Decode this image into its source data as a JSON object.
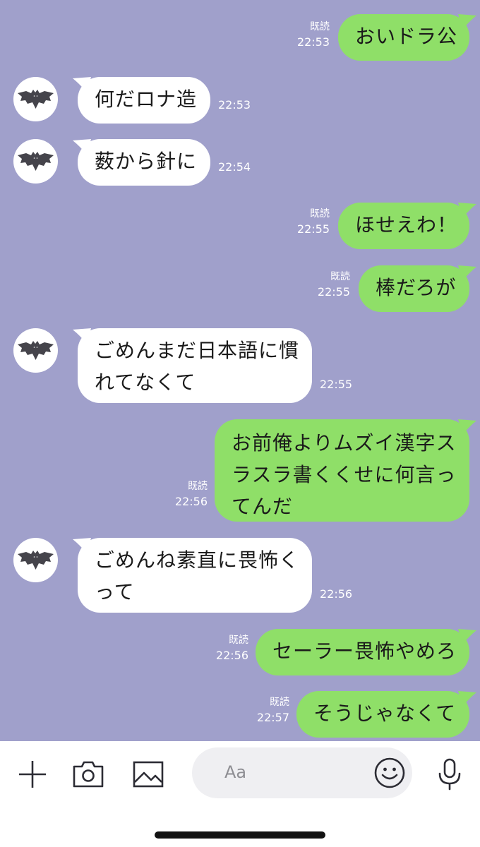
{
  "chat": {
    "read_label": "既読",
    "messages": [
      {
        "side": "out",
        "lines": [
          "おいドラ公"
        ],
        "time": "22:53"
      },
      {
        "side": "in",
        "lines": [
          "何だロナ造"
        ],
        "time": "22:53"
      },
      {
        "side": "in",
        "lines": [
          "薮から針に"
        ],
        "time": "22:54"
      },
      {
        "side": "out",
        "lines": [
          "ほせえわ！"
        ],
        "time": "22:55"
      },
      {
        "side": "out",
        "lines": [
          "棒だろが"
        ],
        "time": "22:55"
      },
      {
        "side": "in",
        "lines": [
          "ごめんまだ日本語に慣",
          "れてなくて"
        ],
        "time": "22:55"
      },
      {
        "side": "out",
        "lines": [
          "お前俺よりムズイ漢字ス",
          "ラスラ書くくせに何言っ",
          "てんだ"
        ],
        "time": "22:56"
      },
      {
        "side": "in",
        "lines": [
          "ごめんね素直に畏怖く",
          "って"
        ],
        "time": "22:56"
      },
      {
        "side": "out",
        "lines": [
          "セーラー畏怖やめろ"
        ],
        "time": "22:56"
      },
      {
        "side": "out",
        "lines": [
          "そうじゃなくて"
        ],
        "time": "22:57"
      }
    ]
  },
  "input_bar": {
    "placeholder": "Aa",
    "icons": [
      "plus-icon",
      "camera-icon",
      "image-icon",
      "emoji-icon",
      "microphone-icon"
    ]
  },
  "colors": {
    "background": "#a0a0cb",
    "outgoing_bubble": "#8fdf68",
    "incoming_bubble": "#ffffff"
  }
}
